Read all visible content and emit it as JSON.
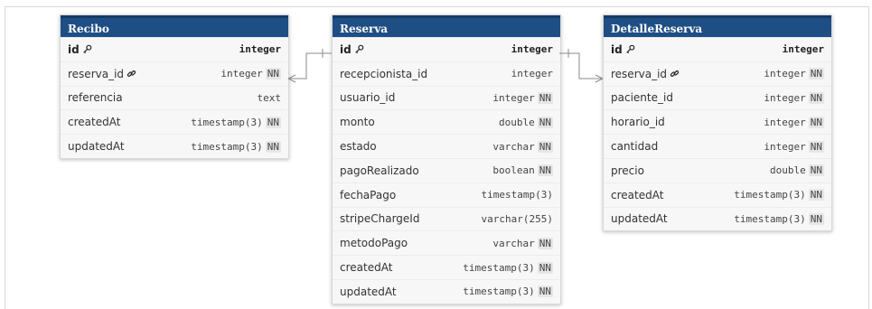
{
  "tables": {
    "recibo": {
      "name": "Recibo",
      "fields": [
        {
          "name": "id",
          "type": "integer",
          "nn": "",
          "icon": "key-icon",
          "pk": true
        },
        {
          "name": "reserva_id",
          "type": "integer",
          "nn": "NN",
          "icon": "link-icon",
          "pk": false
        },
        {
          "name": "referencia",
          "type": "text",
          "nn": "",
          "icon": "",
          "pk": false
        },
        {
          "name": "createdAt",
          "type": "timestamp(3)",
          "nn": "NN",
          "icon": "",
          "pk": false
        },
        {
          "name": "updatedAt",
          "type": "timestamp(3)",
          "nn": "NN",
          "icon": "",
          "pk": false
        }
      ]
    },
    "reserva": {
      "name": "Reserva",
      "fields": [
        {
          "name": "id",
          "type": "integer",
          "nn": "",
          "icon": "key-icon",
          "pk": true
        },
        {
          "name": "recepcionista_id",
          "type": "integer",
          "nn": "",
          "icon": "",
          "pk": false
        },
        {
          "name": "usuario_id",
          "type": "integer",
          "nn": "NN",
          "icon": "",
          "pk": false
        },
        {
          "name": "monto",
          "type": "double",
          "nn": "NN",
          "icon": "",
          "pk": false
        },
        {
          "name": "estado",
          "type": "varchar",
          "nn": "NN",
          "icon": "",
          "pk": false
        },
        {
          "name": "pagoRealizado",
          "type": "boolean",
          "nn": "NN",
          "icon": "",
          "pk": false
        },
        {
          "name": "fechaPago",
          "type": "timestamp(3)",
          "nn": "",
          "icon": "",
          "pk": false
        },
        {
          "name": "stripeChargeId",
          "type": "varchar(255)",
          "nn": "",
          "icon": "",
          "pk": false
        },
        {
          "name": "metodoPago",
          "type": "varchar",
          "nn": "NN",
          "icon": "",
          "pk": false
        },
        {
          "name": "createdAt",
          "type": "timestamp(3)",
          "nn": "NN",
          "icon": "",
          "pk": false
        },
        {
          "name": "updatedAt",
          "type": "timestamp(3)",
          "nn": "NN",
          "icon": "",
          "pk": false
        }
      ]
    },
    "detalle": {
      "name": "DetalleReserva",
      "fields": [
        {
          "name": "id",
          "type": "integer",
          "nn": "",
          "icon": "key-icon",
          "pk": true
        },
        {
          "name": "reserva_id",
          "type": "integer",
          "nn": "NN",
          "icon": "link-icon",
          "pk": false
        },
        {
          "name": "paciente_id",
          "type": "integer",
          "nn": "NN",
          "icon": "",
          "pk": false
        },
        {
          "name": "horario_id",
          "type": "integer",
          "nn": "NN",
          "icon": "",
          "pk": false
        },
        {
          "name": "cantidad",
          "type": "integer",
          "nn": "NN",
          "icon": "",
          "pk": false
        },
        {
          "name": "precio",
          "type": "double",
          "nn": "NN",
          "icon": "",
          "pk": false
        },
        {
          "name": "createdAt",
          "type": "timestamp(3)",
          "nn": "NN",
          "icon": "",
          "pk": false
        },
        {
          "name": "updatedAt",
          "type": "timestamp(3)",
          "nn": "NN",
          "icon": "",
          "pk": false
        }
      ]
    }
  },
  "colors": {
    "header": "#1f4e85",
    "connector": "#8a8a8a"
  }
}
